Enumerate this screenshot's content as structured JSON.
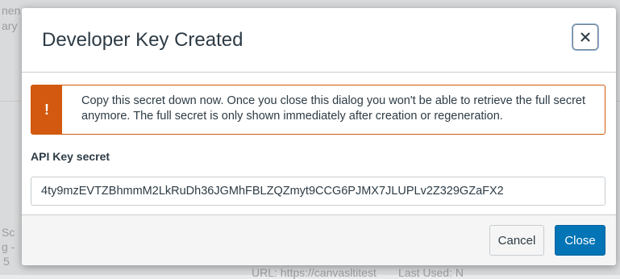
{
  "background": {
    "fragments": [
      "nen",
      "ary",
      "Sc",
      "g -",
      "5",
      "URL: https://canvasltitest",
      "Last Used: N"
    ]
  },
  "dialog": {
    "title": "Developer Key Created",
    "close_icon": "close-icon",
    "alert": {
      "icon": "!",
      "message": "Copy this secret down now. Once you close this dialog you won't be able to retrieve the full secret anymore. The full secret is only shown immediately after creation or regeneration."
    },
    "field_label": "API Key secret",
    "field_value": "4ty9mzEVTZBhmmM2LkRuDh36JGMhFBLZQZmyt9CCG6PJMX7JLUPLv2Z329GZaFX2",
    "buttons": {
      "cancel": "Cancel",
      "close": "Close"
    }
  },
  "colors": {
    "warning": "#d2590f",
    "primary": "#0374b5",
    "text": "#2d3b45"
  }
}
